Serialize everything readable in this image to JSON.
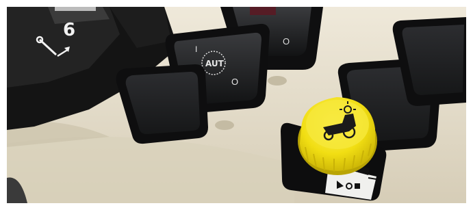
{
  "photo": {
    "subject": "tractor-control-console",
    "colors": {
      "panel": "#e4ddcb",
      "panel_shadow": "#b9b19c",
      "switch_black": "#1c1d1f",
      "knob_yellow": "#f3e21a",
      "dark_body": "#151515"
    }
  },
  "labels": {
    "lever_gear_number": "6",
    "rocker_top_mark": "I",
    "rocker_mode_text": "AUT",
    "rocker_bottom_mark": "O",
    "top_switch_mark": "O"
  },
  "icons": {
    "lever_icon": "lever-arrow-icon",
    "knob_icon": "tractor-pto-icon",
    "plate_top_icon": "engage-symbol-icon",
    "plate_bottom_icon": "disengage-symbol-icon"
  }
}
